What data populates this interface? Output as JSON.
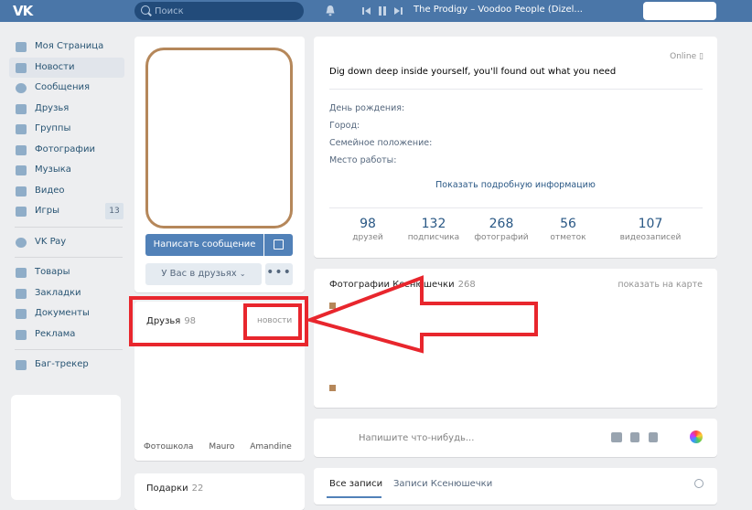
{
  "header": {
    "logo": "VK",
    "search_placeholder": "Поиск",
    "track": "The Prodigy – Voodoo People (Dizel..."
  },
  "sidebar": {
    "items": [
      {
        "label": "Моя Страница",
        "icon": "home-icon"
      },
      {
        "label": "Новости",
        "icon": "news-icon",
        "active": true
      },
      {
        "label": "Сообщения",
        "icon": "messages-icon"
      },
      {
        "label": "Друзья",
        "icon": "friends-icon"
      },
      {
        "label": "Группы",
        "icon": "groups-icon"
      },
      {
        "label": "Фотографии",
        "icon": "camera-icon"
      },
      {
        "label": "Музыка",
        "icon": "music-icon"
      },
      {
        "label": "Видео",
        "icon": "video-icon"
      },
      {
        "label": "Игры",
        "icon": "gamepad-icon",
        "badge": "13"
      }
    ],
    "vkpay": "VK Pay",
    "items2": [
      {
        "label": "Товары",
        "icon": "cart-icon"
      },
      {
        "label": "Закладки",
        "icon": "star-icon"
      },
      {
        "label": "Документы",
        "icon": "document-icon"
      },
      {
        "label": "Реклама",
        "icon": "megaphone-icon"
      }
    ],
    "bugtracker": "Баг-трекер"
  },
  "profile": {
    "send_message": "Написать сообщение",
    "in_friends": "У Вас в друзьях",
    "more": "•••",
    "friends_title": "Друзья",
    "friends_count": "98",
    "friends_news": "новости",
    "friend_names": [
      "Фотошкола",
      "Mauro",
      "Amandine"
    ],
    "gifts_title": "Подарки",
    "gifts_count": "22"
  },
  "info": {
    "online": "Online",
    "status": "Dig down deep inside yourself, you'll found out what you need",
    "rows": [
      {
        "label": "День рождения:"
      },
      {
        "label": "Город:"
      },
      {
        "label": "Семейное положение:"
      },
      {
        "label": "Место работы:"
      }
    ],
    "show_more": "Показать подробную информацию",
    "counters": [
      {
        "num": "98",
        "label": "друзей"
      },
      {
        "num": "132",
        "label": "подписчика"
      },
      {
        "num": "268",
        "label": "фотографий"
      },
      {
        "num": "56",
        "label": "отметок"
      },
      {
        "num": "107",
        "label": "видеозаписей"
      }
    ]
  },
  "photos": {
    "title": "Фотографии Ксенюшечки",
    "count": "268",
    "map_link": "показать на карте"
  },
  "post": {
    "placeholder": "Напишите что-нибудь..."
  },
  "wall": {
    "tab_all": "Все записи",
    "tab_own": "Записи Ксенюшечки"
  },
  "colors": {
    "header": "#4a76a8",
    "accent": "#5181b8",
    "annotation": "#e8262d"
  }
}
